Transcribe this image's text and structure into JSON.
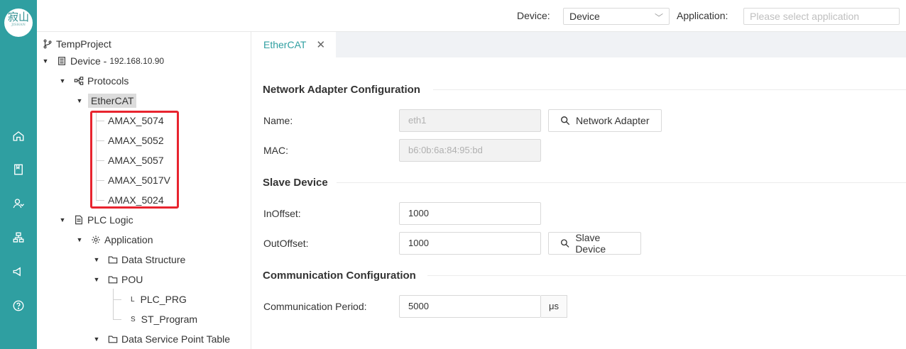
{
  "rail": {
    "logo_text": "寂山",
    "logo_sub": "JISHAN",
    "icons": [
      "home-icon",
      "book-icon",
      "users-icon",
      "network-icon",
      "announce-icon",
      "help-icon"
    ]
  },
  "topbar": {
    "device_label": "Device:",
    "device_value": "Device",
    "application_label": "Application:",
    "application_placeholder": "Please select application"
  },
  "tree": {
    "project": "TempProject",
    "device": "Device - ",
    "device_ip": "192.168.10.90",
    "protocols": "Protocols",
    "ethercat": "EtherCAT",
    "slaves": [
      "AMAX_5074",
      "AMAX_5052",
      "AMAX_5057",
      "AMAX_5017V",
      "AMAX_5024"
    ],
    "plc_logic": "PLC Logic",
    "application": "Application",
    "data_structure": "Data Structure",
    "pou": "POU",
    "plc_prg": "PLC_PRG",
    "plc_prg_prefix": "L",
    "st_program": "ST_Program",
    "st_program_prefix": "S",
    "data_service": "Data Service Point Table"
  },
  "tab": {
    "label": "EtherCAT",
    "close": "✕"
  },
  "network": {
    "title": "Network Adapter Configuration",
    "name_label": "Name:",
    "name_value": "eth1",
    "mac_label": "MAC:",
    "mac_value": "b6:0b:6a:84:95:bd",
    "adapter_button": "Network Adapter"
  },
  "slave": {
    "title": "Slave Device",
    "in_label": "InOffset:",
    "in_value": "1000",
    "out_label": "OutOffset:",
    "out_value": "1000",
    "slave_button": "Slave Device"
  },
  "comm": {
    "title": "Communication Configuration",
    "period_label": "Communication Period:",
    "period_value": "5000",
    "unit": "μs"
  },
  "colors": {
    "accent": "#2f9fa1",
    "highlight_box": "#e8242f"
  }
}
